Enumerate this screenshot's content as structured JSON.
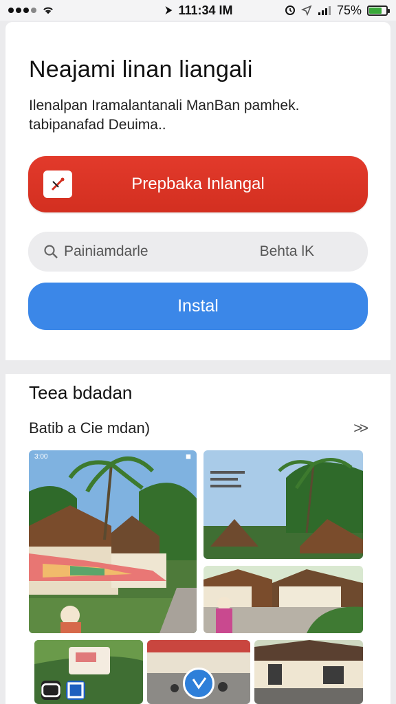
{
  "status_bar": {
    "time": "111:34 IM",
    "battery": "75%"
  },
  "header": {
    "title": "Neajami linan liangali",
    "description": "Ilenalpan Iramalantanali ManBan pamhek. tabipanafad Deuima.."
  },
  "primary_action": {
    "label": "Prepbaka Inlangal"
  },
  "search": {
    "placeholder": "Painiamdarle",
    "right_label": "Behta lK"
  },
  "install": {
    "label": "Instal"
  },
  "section": {
    "title": "Teea bdadan",
    "subtitle": "Batib a Cie mdan)",
    "more_icon": "chevron-double-right"
  },
  "screenshots": {
    "shot1_time": "3:00"
  },
  "colors": {
    "red": "#d32f20",
    "blue": "#3b87e8",
    "search_bg": "#ececee"
  }
}
